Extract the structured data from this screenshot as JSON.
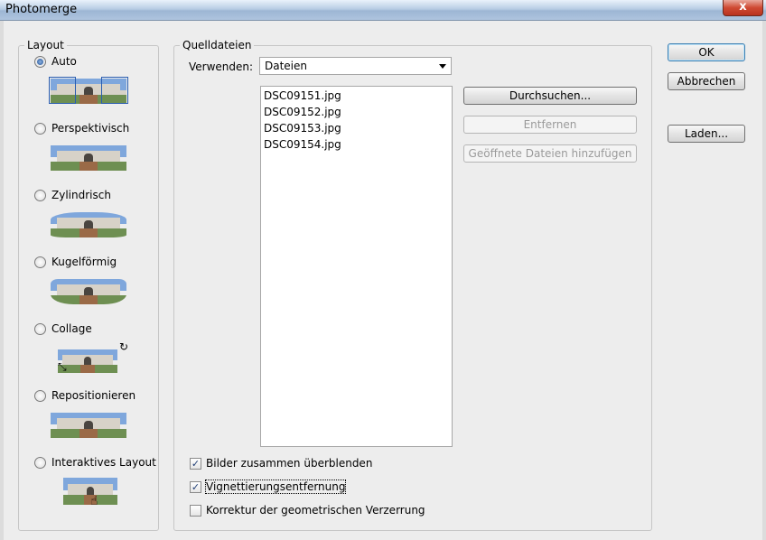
{
  "window": {
    "title": "Photomerge",
    "close_label": "x"
  },
  "layout": {
    "legend": "Layout",
    "options": [
      {
        "label": "Auto",
        "selected": true
      },
      {
        "label": "Perspektivisch",
        "selected": false
      },
      {
        "label": "Zylindrisch",
        "selected": false
      },
      {
        "label": "Kugelförmig",
        "selected": false
      },
      {
        "label": "Collage",
        "selected": false
      },
      {
        "label": "Repositionieren",
        "selected": false
      },
      {
        "label": "Interaktives Layout",
        "selected": false
      }
    ]
  },
  "source": {
    "legend": "Quelldateien",
    "use_label": "Verwenden:",
    "use_value": "Dateien",
    "files": [
      "DSC09151.jpg",
      "DSC09152.jpg",
      "DSC09153.jpg",
      "DSC09154.jpg"
    ],
    "browse_label": "Durchsuchen...",
    "remove_label": "Entfernen",
    "add_open_label": "Geöffnete Dateien hinzufügen"
  },
  "options": [
    {
      "label": "Bilder zusammen überblenden",
      "checked": true
    },
    {
      "label": "Vignettierungsentfernung",
      "checked": true
    },
    {
      "label": "Korrektur der geometrischen Verzerrung",
      "checked": false
    }
  ],
  "buttons": {
    "ok": "OK",
    "cancel": "Abbrechen",
    "load": "Laden..."
  },
  "colors": {
    "accent": "#1d4f96",
    "sky": "#7fa7dc"
  }
}
